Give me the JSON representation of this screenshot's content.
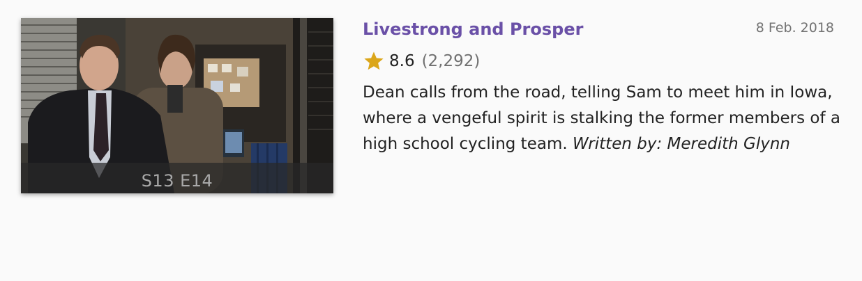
{
  "episode": {
    "thumbnail_label": "S13 E14",
    "title": "Livestrong and Prosper",
    "air_date": "8 Feb. 2018",
    "rating": "8.6",
    "rating_count": "(2,292)",
    "description": "Dean calls from the road, telling Sam to meet him in Iowa, where a vengeful spirit is stalking the former members of a high school cycling team.",
    "written_by_label": "Written by:",
    "writer": "Meredith Glynn"
  },
  "colors": {
    "title": "#6a50a7",
    "star": "#dba61a",
    "date": "#737373",
    "background": "#fafafa"
  },
  "icons": {
    "rating": "star-icon"
  }
}
